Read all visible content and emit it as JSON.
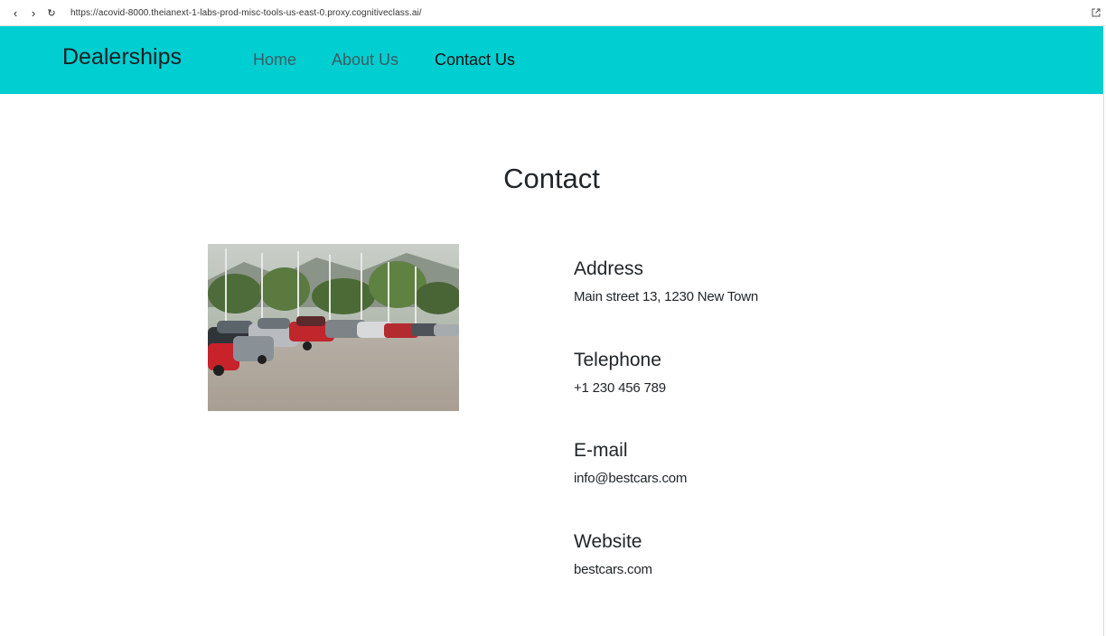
{
  "browser": {
    "url": "https://acovid-8000.theianext-1-labs-prod-misc-tools-us-east-0.proxy.cognitiveclass.ai/",
    "back_icon": "chevron-left-icon",
    "forward_icon": "chevron-right-icon",
    "reload_icon": "reload-icon",
    "open_external_icon": "external-link-icon"
  },
  "navbar": {
    "brand": "Dealerships",
    "links": [
      {
        "label": "Home"
      },
      {
        "label": "About Us"
      },
      {
        "label": "Contact Us"
      }
    ],
    "active": "Contact Us",
    "background_color": "#00ced1"
  },
  "main": {
    "title": "Contact",
    "image_alt": "car dealership parking lot",
    "contacts": [
      {
        "heading": "Address",
        "value": "Main street 13, 1230 New Town"
      },
      {
        "heading": "Telephone",
        "value": "+1 230 456 789"
      },
      {
        "heading": "E-mail",
        "value": "info@bestcars.com"
      },
      {
        "heading": "Website",
        "value": "bestcars.com"
      }
    ]
  }
}
